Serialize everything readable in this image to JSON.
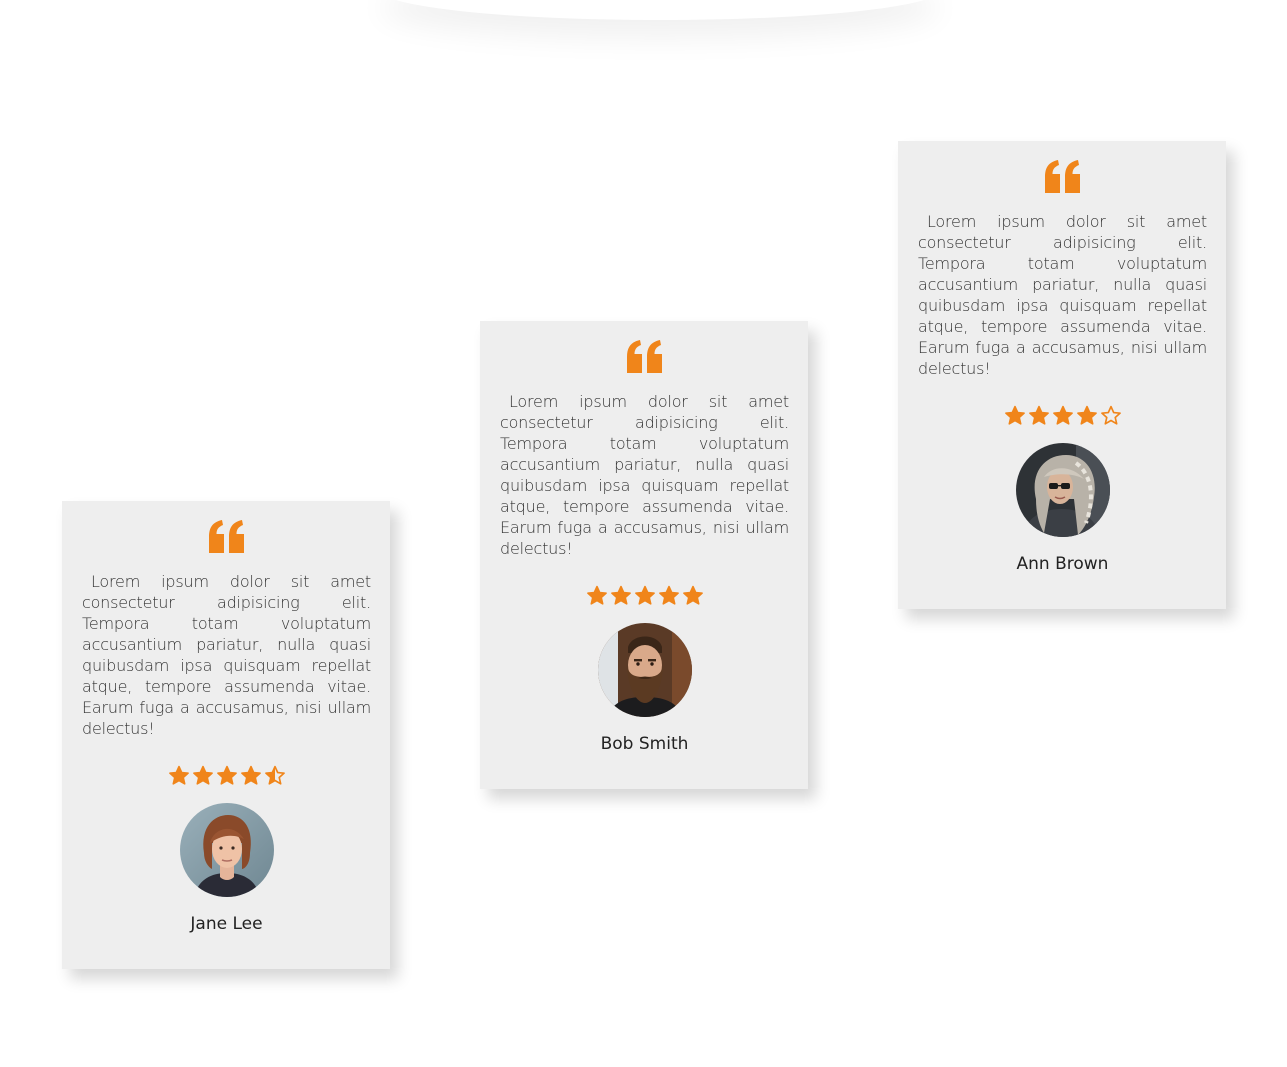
{
  "accent_color": "#f0851a",
  "card_background": "#eeeeee",
  "testimonials": [
    {
      "text": "Lorem ipsum dolor sit amet consectetur adipisicing elit. Tempora totam voluptatum accusantium pariatur, nulla quasi quibusdam ipsa quisquam repellat atque, tempore assumenda vitae. Earum fuga a accusamus, nisi ullam delectus!",
      "rating": 4.5,
      "name": "Jane Lee",
      "quote_icon": "quote-icon",
      "avatar": "woman-portrait"
    },
    {
      "text": "Lorem ipsum dolor sit amet consectetur adipisicing elit. Tempora totam voluptatum accusantium pariatur, nulla quasi quibusdam ipsa quisquam repellat atque, tempore assumenda vitae. Earum fuga a accusamus, nisi ullam delectus!",
      "rating": 5,
      "name": "Bob Smith",
      "quote_icon": "quote-icon",
      "avatar": "bearded-man-portrait"
    },
    {
      "text": "Lorem ipsum dolor sit amet consectetur adipisicing elit. Tempora totam voluptatum accusantium pariatur, nulla quasi quibusdam ipsa quisquam repellat atque, tempore assumenda vitae. Earum fuga a accusamus, nisi ullam delectus!",
      "rating": 4,
      "name": "Ann Brown",
      "quote_icon": "quote-icon",
      "avatar": "gray-haired-woman-portrait"
    }
  ]
}
